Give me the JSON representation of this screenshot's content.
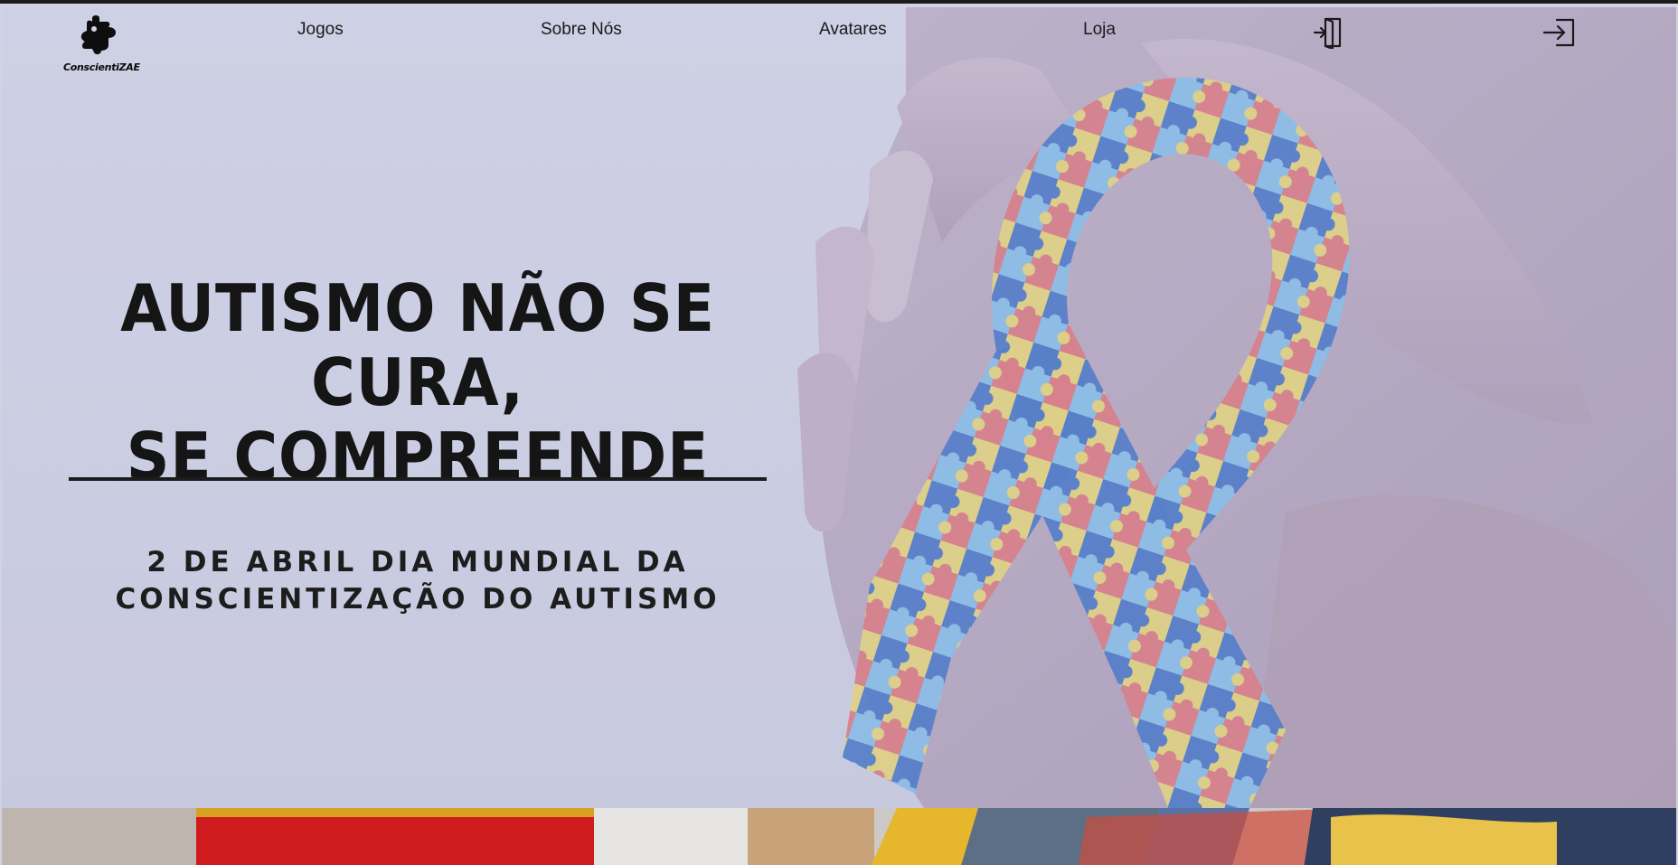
{
  "brand": {
    "name": "ConscientiZAE"
  },
  "nav": {
    "links": [
      "Jogos",
      "Sobre Nós",
      "Avatares",
      "Loja"
    ]
  },
  "hero": {
    "headline_line1": "AUTISMO NÃO SE CURA,",
    "headline_line2": "SE COMPREENDE",
    "subline_line1": "2 DE ABRIL DIA MUNDIAL DA",
    "subline_line2": "CONSCIENTIZAÇÃO DO AUTISMO"
  },
  "icons": {
    "login": "door-enter-icon",
    "signin": "arrow-into-box-icon"
  },
  "colors": {
    "hero_bg": "#cfd0e6",
    "text_dark": "#151515",
    "puzzle_red": "#d8707a",
    "puzzle_blue": "#3f6ec4",
    "puzzle_lightblue": "#7fb8e6",
    "puzzle_yellow": "#e2cf74"
  }
}
